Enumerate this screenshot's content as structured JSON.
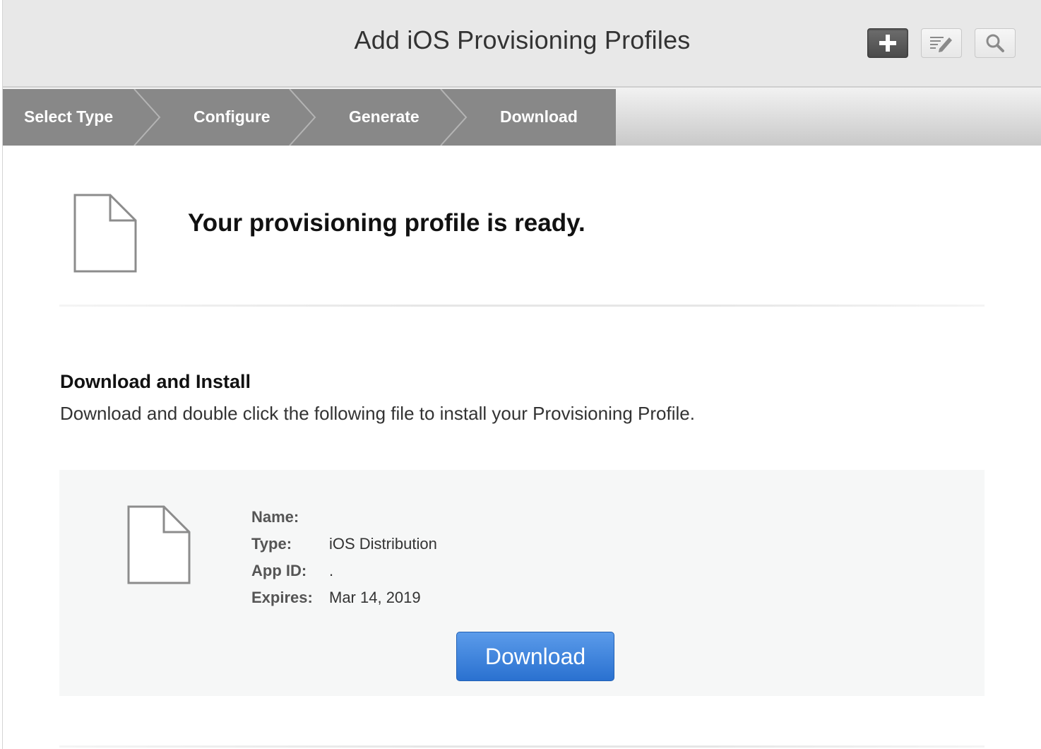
{
  "header": {
    "title": "Add iOS Provisioning Profiles",
    "buttons": [
      {
        "name": "add",
        "icon": "plus-icon"
      },
      {
        "name": "edit",
        "icon": "edit-icon"
      },
      {
        "name": "search",
        "icon": "search-icon"
      }
    ]
  },
  "steps": [
    {
      "label": "Select Type"
    },
    {
      "label": "Configure"
    },
    {
      "label": "Generate"
    },
    {
      "label": "Download"
    }
  ],
  "ready": {
    "icon": "document-icon",
    "title": "Your provisioning profile is ready."
  },
  "install": {
    "heading": "Download and Install",
    "description": "Download and double click the following file to install your Provisioning Profile."
  },
  "profile": {
    "icon": "document-icon",
    "fields": [
      {
        "label": "Name:",
        "value": ""
      },
      {
        "label": "Type:",
        "value": "iOS Distribution"
      },
      {
        "label": "App ID:",
        "value": "."
      },
      {
        "label": "Expires:",
        "value": "Mar 14, 2019"
      }
    ],
    "download_label": "Download"
  },
  "colors": {
    "header_bg": "#e8e8e8",
    "step_bg": "#888888",
    "button_blue": "#2a71d0",
    "panel_bg": "#f6f7f7"
  }
}
